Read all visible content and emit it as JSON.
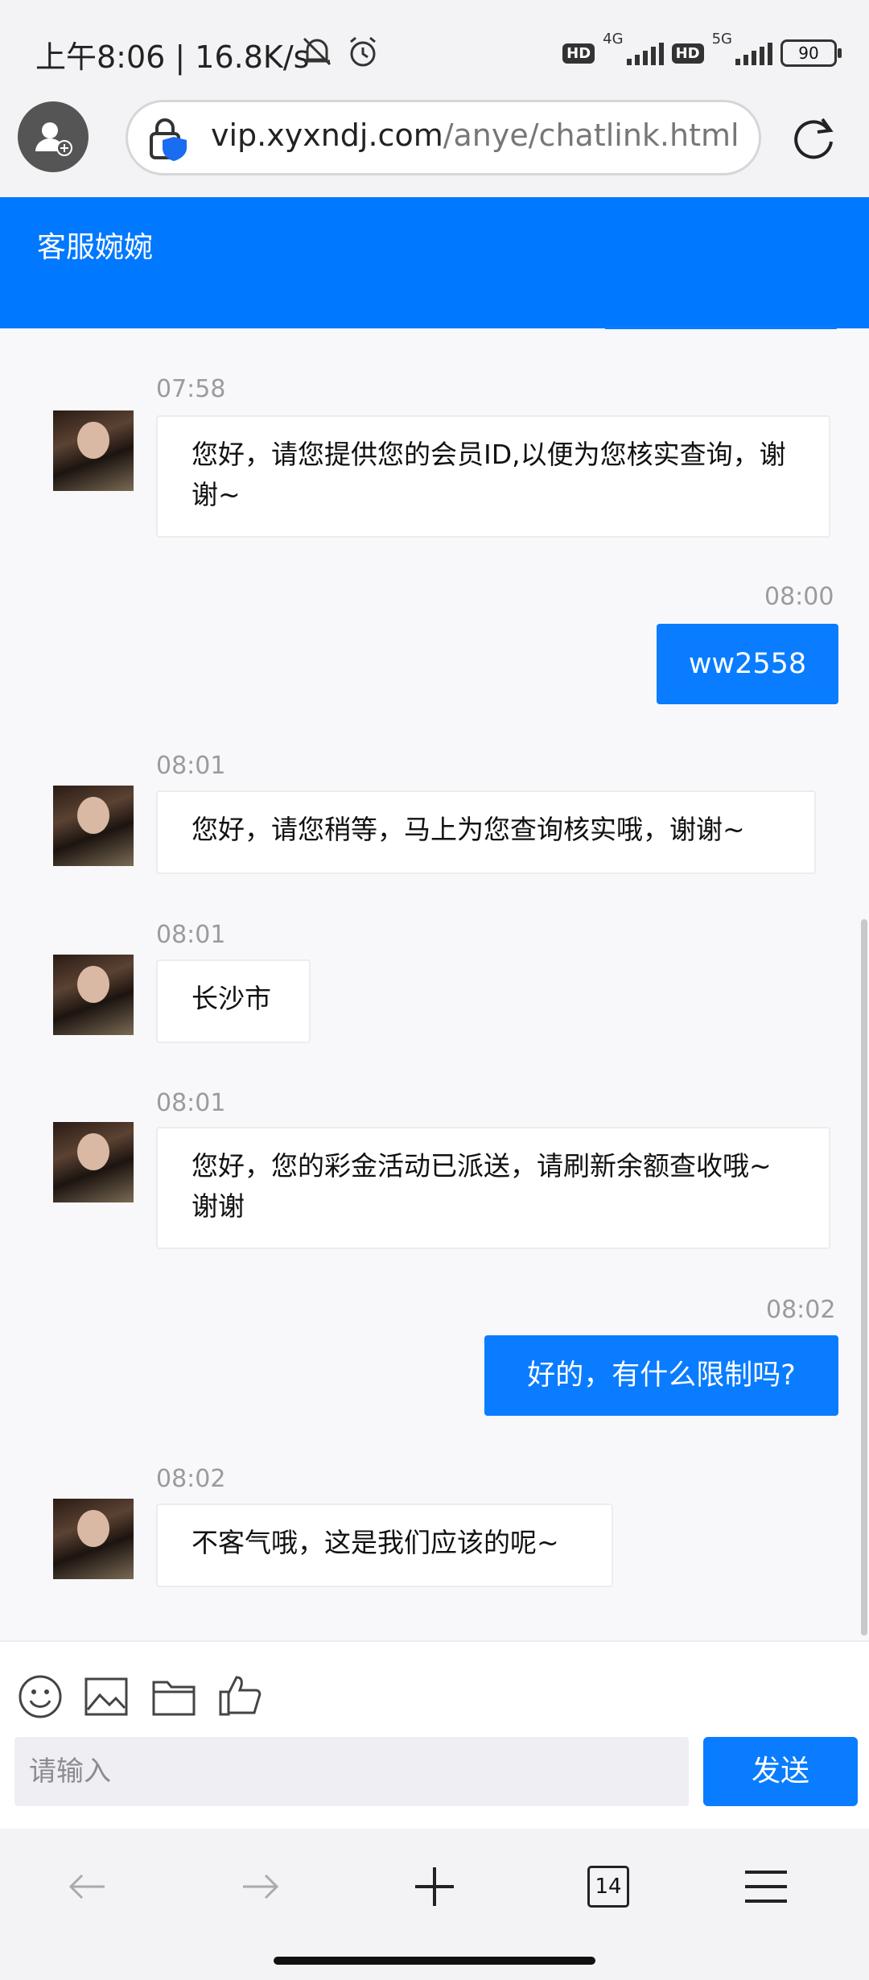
{
  "status_bar": {
    "time": "上午8:06 | 16.8K/s",
    "network1": "4G",
    "network2": "5G",
    "hd_badge": "HD",
    "battery": "90"
  },
  "browser": {
    "url_host": "vip.xyxndj.com",
    "url_path": "/anye/chatlink.html",
    "tab_count": "14"
  },
  "chat": {
    "title": "客服婉婉",
    "messages": [
      {
        "side": "left",
        "time": "07:58",
        "text": "您好，请您提供您的会员ID,以便为您核实查询，谢谢~"
      },
      {
        "side": "right",
        "time": "08:00",
        "text": "ww2558"
      },
      {
        "side": "left",
        "time": "08:01",
        "text": "您好，请您稍等，马上为您查询核实哦，谢谢~"
      },
      {
        "side": "left",
        "time": "08:01",
        "text": "长沙市"
      },
      {
        "side": "left",
        "time": "08:01",
        "text": "您好，您的彩金活动已派送，请刷新余额查收哦~谢谢"
      },
      {
        "side": "right",
        "time": "08:02",
        "text": "好的，有什么限制吗?"
      },
      {
        "side": "left",
        "time": "08:02",
        "text": "不客气哦，这是我们应该的呢~"
      }
    ]
  },
  "composer": {
    "placeholder": "请输入",
    "send_label": "发送"
  },
  "colors": {
    "accent": "#0a7cff",
    "header": "#0078ff"
  }
}
